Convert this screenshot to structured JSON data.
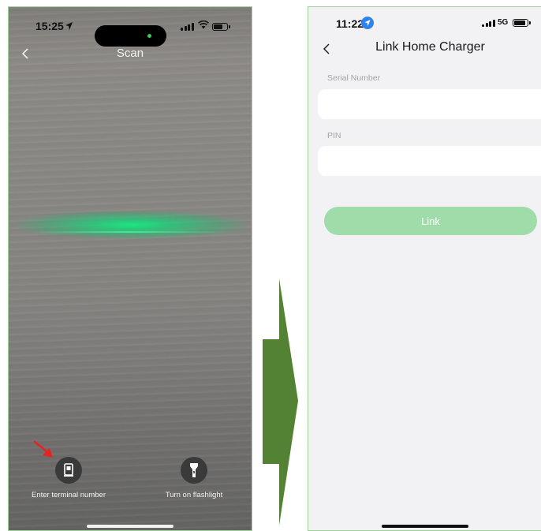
{
  "left_phone": {
    "status": {
      "time": "15:25"
    },
    "title": "Scan",
    "tools": [
      {
        "label": "Enter terminal number"
      },
      {
        "label": "Turn on flashlight"
      }
    ]
  },
  "right_phone": {
    "status": {
      "time": "11:22",
      "network": "5G"
    },
    "title": "Link Home Charger",
    "fields": [
      {
        "label": "Serial Number",
        "value": "",
        "placeholder": ""
      },
      {
        "label": "PIN",
        "value": "",
        "placeholder": ""
      }
    ],
    "link_button": "Link"
  },
  "colors": {
    "scan_glow": "#19e682",
    "link_button_disabled": "#9fdcaa",
    "transition_arrow": "#548235",
    "annotation_arrow": "#e8231f",
    "location_badge": "#2f83f0"
  },
  "icons": {
    "left_back": "chevron-left-icon",
    "terminal": "terminal-device-icon",
    "flashlight": "flashlight-icon",
    "right_back": "chevron-left-icon"
  }
}
